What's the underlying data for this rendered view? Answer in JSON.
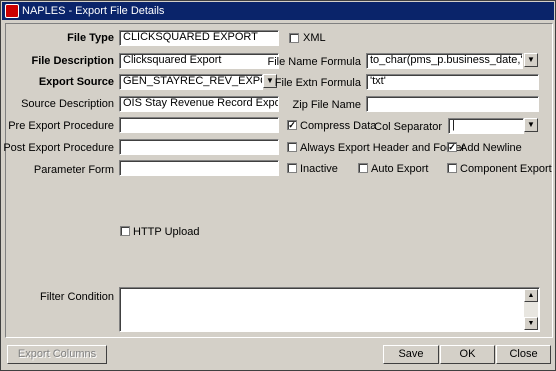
{
  "window": {
    "title": "NAPLES - Export File Details"
  },
  "form": {
    "file_type": {
      "label": "File Type",
      "value": "CLICKSQUARED EXPORT"
    },
    "xml": {
      "label": "XML",
      "checked": false
    },
    "file_description": {
      "label": "File Description",
      "value": "Clicksquared Export"
    },
    "file_name_formula": {
      "label": "File Name Formula",
      "value": "to_char(pms_p.business_date,'YYYY"
    },
    "export_source": {
      "label": "Export Source",
      "value": "GEN_STAYREC_REV_EXPORT_V"
    },
    "file_extn_formula": {
      "label": "File Extn Formula",
      "value": "'txt'"
    },
    "source_description": {
      "label": "Source Description",
      "value": "OIS Stay Revenue Record Export."
    },
    "zip_file_name": {
      "label": "Zip File Name",
      "value": ""
    },
    "pre_export_procedure": {
      "label": "Pre Export Procedure",
      "value": ""
    },
    "compress_data": {
      "label": "Compress Data",
      "checked": true
    },
    "col_separator": {
      "label": "Col Separator",
      "value": "|"
    },
    "post_export_procedure": {
      "label": "Post Export Procedure",
      "value": ""
    },
    "always_export_header_footer": {
      "label": "Always Export Header and Footer",
      "checked": false
    },
    "add_newline": {
      "label": "Add Newline",
      "checked": true
    },
    "parameter_form": {
      "label": "Parameter Form",
      "value": ""
    },
    "inactive": {
      "label": "Inactive",
      "checked": false
    },
    "auto_export": {
      "label": "Auto Export",
      "checked": false
    },
    "component_export": {
      "label": "Component Export",
      "checked": false
    },
    "http_upload": {
      "label": "HTTP Upload",
      "checked": false
    },
    "filter_condition": {
      "label": "Filter Condition",
      "value": ""
    }
  },
  "icons": {
    "lov": "down-arrow-icon",
    "check": "✓"
  },
  "buttons": {
    "export_columns": "Export Columns",
    "save": "Save",
    "ok": "OK",
    "close": "Close"
  }
}
